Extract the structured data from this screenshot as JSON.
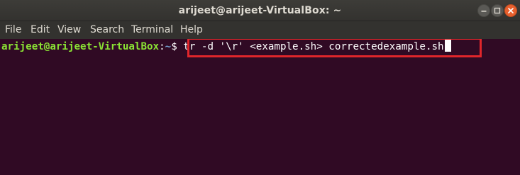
{
  "window": {
    "title": "arijeet@arijeet-VirtualBox: ~",
    "controls": {
      "minimize_icon": "minimize-icon",
      "maximize_icon": "maximize-icon",
      "close_icon": "close-icon"
    }
  },
  "menu": {
    "items": [
      "File",
      "Edit",
      "View",
      "Search",
      "Terminal",
      "Help"
    ]
  },
  "terminal": {
    "prompt_user_host": "arijeet@arijeet-VirtualBox",
    "prompt_separator": ":",
    "prompt_path": "~",
    "prompt_symbol": "$ ",
    "command": "tr -d '\\r' <example.sh> correctedexample.sh"
  },
  "colors": {
    "terminal_background": "#300a24",
    "prompt_user_color": "#8ae234",
    "prompt_path_color": "#729fcf",
    "highlight_border": "#e0262b",
    "close_button": "#e8602e"
  }
}
